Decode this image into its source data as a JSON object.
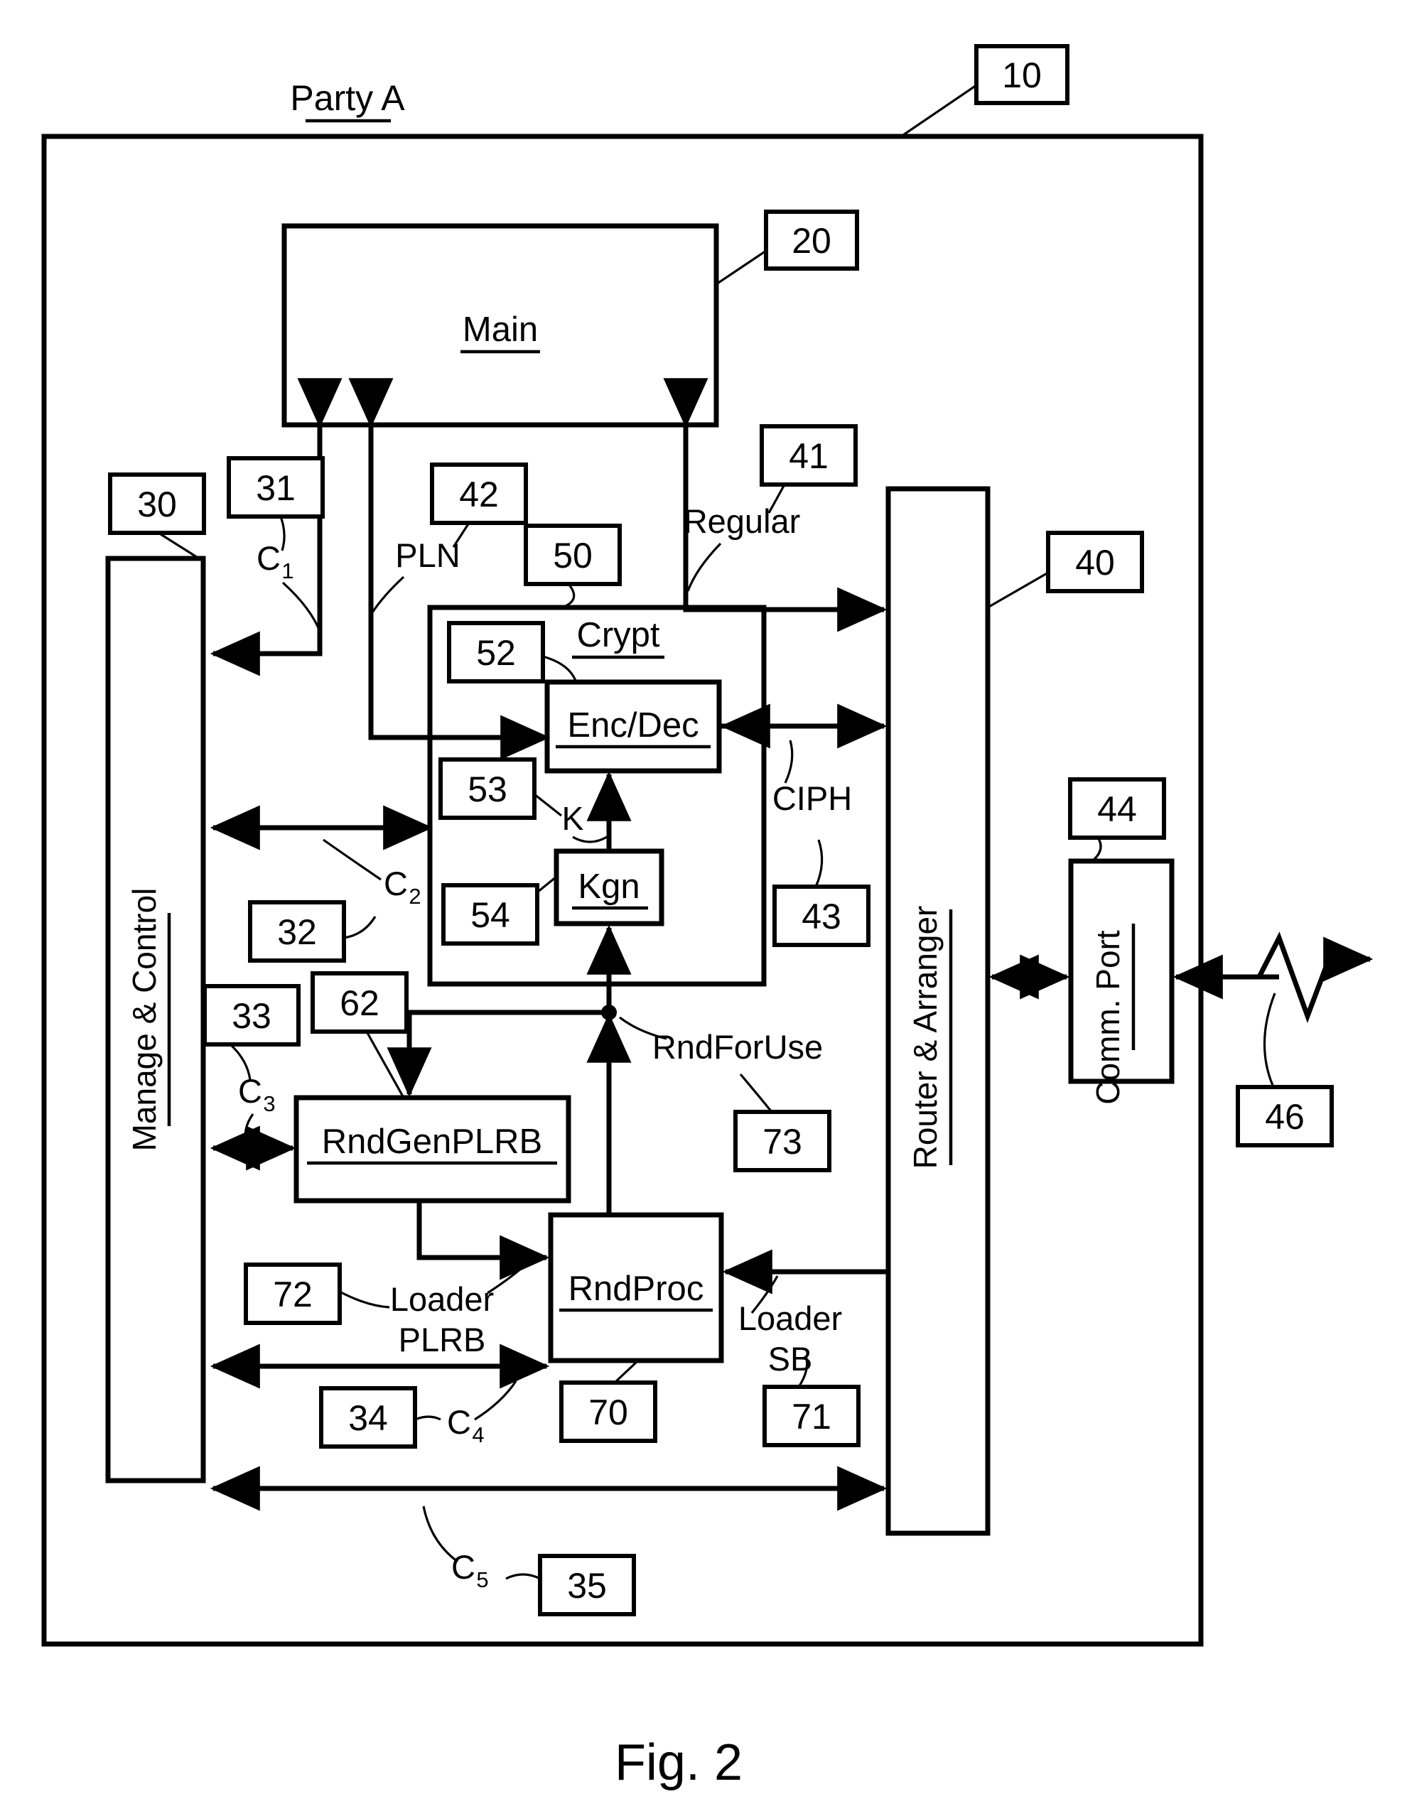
{
  "figure": {
    "title": "Party A",
    "caption": "Fig. 2"
  },
  "blocks": {
    "main": "Main",
    "manage_control": "Manage & Control",
    "crypt": "Crypt",
    "enc_dec": "Enc/Dec",
    "kgn": "Kgn",
    "rndgenplrb": "RndGenPLRB",
    "rndproc": "RndProc",
    "router_arranger": "Router & Arranger",
    "comm_port": "Comm. Port"
  },
  "signals": {
    "c1": "C",
    "c1_sub": "1",
    "c2": "C",
    "c2_sub": "2",
    "c3": "C",
    "c3_sub": "3",
    "c4": "C",
    "c4_sub": "4",
    "c5": "C",
    "c5_sub": "5",
    "pln": "PLN",
    "regular": "Regular",
    "ciph": "CIPH",
    "k": "K",
    "rnd_for_use": "RndForUse",
    "loader_plrb_line1": "Loader",
    "loader_plrb_line2": "PLRB",
    "loader_sb_line1": "Loader",
    "loader_sb_line2": "SB"
  },
  "reference_numerals": {
    "n10": "10",
    "n20": "20",
    "n30": "30",
    "n31": "31",
    "n32": "32",
    "n33": "33",
    "n34": "34",
    "n35": "35",
    "n40": "40",
    "n41": "41",
    "n42": "42",
    "n43": "43",
    "n44": "44",
    "n46": "46",
    "n50": "50",
    "n52": "52",
    "n53": "53",
    "n54": "54",
    "n62": "62",
    "n70": "70",
    "n71": "71",
    "n72": "72",
    "n73": "73"
  },
  "colors": {
    "ink": "#000000",
    "paper": "#ffffff"
  }
}
